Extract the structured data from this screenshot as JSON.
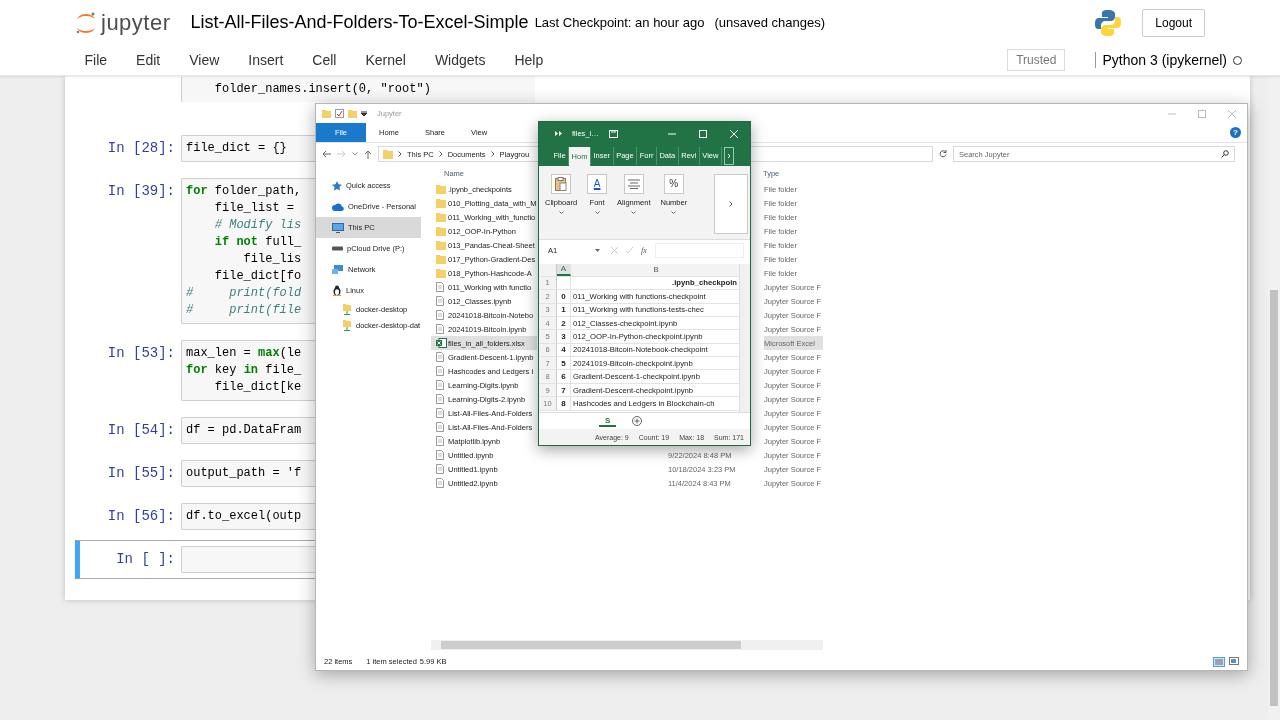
{
  "jupyter": {
    "logo_text": "jupyter",
    "notebook_name": "List-All-Files-And-Folders-To-Excel-Simple",
    "checkpoint": "Last Checkpoint: an hour ago",
    "autosave": "(unsaved changes)",
    "logout": "Logout",
    "menu": [
      "File",
      "Edit",
      "View",
      "Insert",
      "Cell",
      "Kernel",
      "Widgets",
      "Help"
    ],
    "trusted": "Trusted",
    "kernel": {
      "name": "Python 3 (ipykernel)",
      "busy": false
    },
    "cells": [
      {
        "selected": false,
        "lines": [
          {
            "kind": "code",
            "text": "    folder_names.insert(0, \"root\")"
          }
        ]
      },
      {
        "prompt": "In [28]:",
        "selected": false,
        "lines": [
          {
            "kind": "code",
            "text": "file_dict = {}"
          }
        ]
      },
      {
        "prompt": "In [39]:",
        "selected": false,
        "lines": [
          {
            "kind": "code",
            "text": "**for** folder_path,"
          },
          {
            "kind": "code",
            "text": "    file_list ="
          },
          {
            "kind": "comment",
            "text": "    # Modify lis"
          },
          {
            "kind": "code",
            "text": "    **if** **not** full_"
          },
          {
            "kind": "code",
            "text": "        file_lis"
          },
          {
            "kind": "code",
            "text": "    file_dict[fo"
          },
          {
            "kind": "comment",
            "text": "#     print(fold"
          },
          {
            "kind": "comment",
            "text": "#     print(file"
          }
        ]
      },
      {
        "prompt": "In [53]:",
        "selected": false,
        "lines": [
          {
            "kind": "code",
            "text": "max_len = **max**(le"
          },
          {
            "kind": "code",
            "text": "**for** key **in** file_"
          },
          {
            "kind": "code",
            "text": "    file_dict[ke"
          }
        ]
      },
      {
        "prompt": "In [54]:",
        "selected": false,
        "lines": [
          {
            "kind": "code",
            "text": "df = pd.DataFram"
          }
        ]
      },
      {
        "prompt": "In [55]:",
        "selected": false,
        "lines": [
          {
            "kind": "code",
            "text": "output_path = 'f"
          }
        ]
      },
      {
        "prompt": "In [56]:",
        "selected": false,
        "lines": [
          {
            "kind": "code",
            "text": "df.to_excel(outp"
          }
        ]
      },
      {
        "prompt": "In [ ]:",
        "selected": true
      }
    ]
  },
  "explorer": {
    "title": "Jupyter",
    "ribbon_tabs": [
      {
        "label": "File",
        "selected": true
      },
      {
        "label": "Home",
        "selected": false
      },
      {
        "label": "Share",
        "selected": false
      },
      {
        "label": "View",
        "selected": false
      }
    ],
    "help": "?",
    "address": [
      "This PC",
      "Documents",
      "Playgrou"
    ],
    "search": {
      "placeholder": "Search Jupyter"
    },
    "nav": [
      {
        "label": "Quick access",
        "kind": "star",
        "selected": false
      },
      {
        "label": "OneDrive - Personal",
        "kind": "cloud",
        "selected": false
      },
      {
        "label": "This PC",
        "kind": "pc",
        "selected": true
      },
      {
        "label": "pCloud Drive (P:)",
        "kind": "drive",
        "selected": false
      },
      {
        "label": "Network",
        "kind": "network",
        "selected": false
      },
      {
        "label": "Linux",
        "kind": "linux",
        "selected": false,
        "children": [
          {
            "label": "docker-desktop",
            "kind": "share",
            "selected": false
          },
          {
            "label": "docker-desktop-dat",
            "kind": "share",
            "selected": false
          }
        ]
      }
    ],
    "columns": {
      "name": "Name",
      "type": "Type"
    },
    "files": [
      {
        "name": ".ipynb_checkpoints",
        "kind": "folder",
        "type": "File folder",
        "selected": false
      },
      {
        "name": "010_Plotting_data_with_M",
        "kind": "folder",
        "type": "File folder",
        "selected": false
      },
      {
        "name": "011_Working_with_functio",
        "kind": "folder",
        "type": "File folder",
        "selected": false
      },
      {
        "name": "012_OOP-In-Python",
        "kind": "folder",
        "type": "File folder",
        "selected": false
      },
      {
        "name": "013_Pandas-Cheat-Sheet",
        "kind": "folder",
        "type": "File folder",
        "selected": false
      },
      {
        "name": "017_Python-Gradient-Des",
        "kind": "folder",
        "type": "File folder",
        "selected": false
      },
      {
        "name": "018_Python-Hashcode-A",
        "kind": "folder",
        "type": "File folder",
        "selected": false
      },
      {
        "name": "011_Working with functio",
        "kind": "notebook",
        "type": "Jupyter Source F",
        "selected": false
      },
      {
        "name": "012_Classes.ipynb",
        "kind": "notebook",
        "type": "Jupyter Source F",
        "selected": false
      },
      {
        "name": "20241018-Bitcoin-Notebo",
        "kind": "notebook",
        "type": "Jupyter Source F",
        "selected": false
      },
      {
        "name": "20241019-Bitcoin.ipynb",
        "kind": "notebook",
        "type": "Jupyter Source F",
        "selected": false
      },
      {
        "name": "files_in_all_folders.xlsx",
        "kind": "excel",
        "type": "Microsoft Excel",
        "selected": true
      },
      {
        "name": "Gradient-Descent-1.ipynb",
        "kind": "notebook",
        "type": "Jupyter Source F",
        "selected": false
      },
      {
        "name": "Hashcodes and Ledgers i",
        "kind": "notebook",
        "type": "Jupyter Source F",
        "selected": false
      },
      {
        "name": "Learning-Digits.ipynb",
        "kind": "notebook",
        "type": "Jupyter Source F",
        "selected": false
      },
      {
        "name": "Learning-Digits-2.ipynb",
        "kind": "notebook",
        "type": "Jupyter Source F",
        "selected": false
      },
      {
        "name": "List-All-Files-And-Folders",
        "kind": "notebook",
        "type": "Jupyter Source F",
        "selected": false
      },
      {
        "name": "List-All-Files-And-Folders",
        "kind": "notebook",
        "type": "Jupyter Source F",
        "selected": false
      },
      {
        "name": "Matplotlib.ipynb",
        "kind": "notebook",
        "type": "Jupyter Source F",
        "selected": false
      },
      {
        "name": "Untitled.ipynb",
        "kind": "notebook",
        "date": "9/22/2024 8:48 PM",
        "type": "Jupyter Source F",
        "selected": false
      },
      {
        "name": "Untitled1.ipynb",
        "kind": "notebook",
        "date": "10/18/2024 3:23 PM",
        "type": "Jupyter Source F",
        "selected": false
      },
      {
        "name": "Untitled2.ipynb",
        "kind": "notebook",
        "date": "11/4/2024 8:43 PM",
        "type": "Jupyter Source F",
        "selected": false
      }
    ],
    "status": {
      "count": "22 items",
      "selection": "1 item selected",
      "size": "5.99 KB"
    }
  },
  "excel": {
    "title": "files_i…",
    "tabs": [
      {
        "label": "File",
        "selected": false
      },
      {
        "label": "Hom",
        "selected": true
      },
      {
        "label": "Inser",
        "selected": false
      },
      {
        "label": "Page",
        "selected": false
      },
      {
        "label": "Forr",
        "selected": false
      },
      {
        "label": "Data",
        "selected": false
      },
      {
        "label": "Revi",
        "selected": false
      },
      {
        "label": "View",
        "selected": false
      }
    ],
    "groups": [
      {
        "label": "Clipboard",
        "kind": "clipboard"
      },
      {
        "label": "Font",
        "kind": "font",
        "glyph": "A"
      },
      {
        "label": "Alignment",
        "kind": "align"
      },
      {
        "label": "Number",
        "kind": "number",
        "glyph": "%"
      }
    ],
    "name_box": "A1",
    "formula_label": "fx",
    "columns": [
      "A",
      "B"
    ],
    "rows": [
      {
        "num": "1",
        "kind": "header",
        "b": ".ipynb_checkpoin"
      },
      {
        "num": "2",
        "kind": "data",
        "a": "0",
        "b": "011_Working with functions-checkpoint"
      },
      {
        "num": "3",
        "kind": "data",
        "a": "1",
        "b": "011_Working with functions-tests-chec"
      },
      {
        "num": "4",
        "kind": "data",
        "a": "2",
        "b": "012_Classes-checkpoint.ipynb"
      },
      {
        "num": "5",
        "kind": "data",
        "a": "3",
        "b": "012_OOP-In-Python-checkpoint.ipynb"
      },
      {
        "num": "6",
        "kind": "data",
        "a": "4",
        "b": "20241018-Bitcoin-Notebook-checkpoint"
      },
      {
        "num": "7",
        "kind": "data",
        "a": "5",
        "b": "20241019-Bitcoin-checkpoint.ipynb"
      },
      {
        "num": "8",
        "kind": "data",
        "a": "6",
        "b": "Gradient-Descent-1-checkpoint.ipynb"
      },
      {
        "num": "9",
        "kind": "data",
        "a": "7",
        "b": "Gradient-Descent-checkpoint.ipynb"
      },
      {
        "num": "10",
        "kind": "data",
        "a": "8",
        "b": "Hashcodes and Ledgers in Blockchain-ch"
      }
    ],
    "sheet_tab": "S",
    "status": [
      "Average: 9",
      "Count: 19",
      "Max: 18",
      "Sum: 171"
    ]
  }
}
